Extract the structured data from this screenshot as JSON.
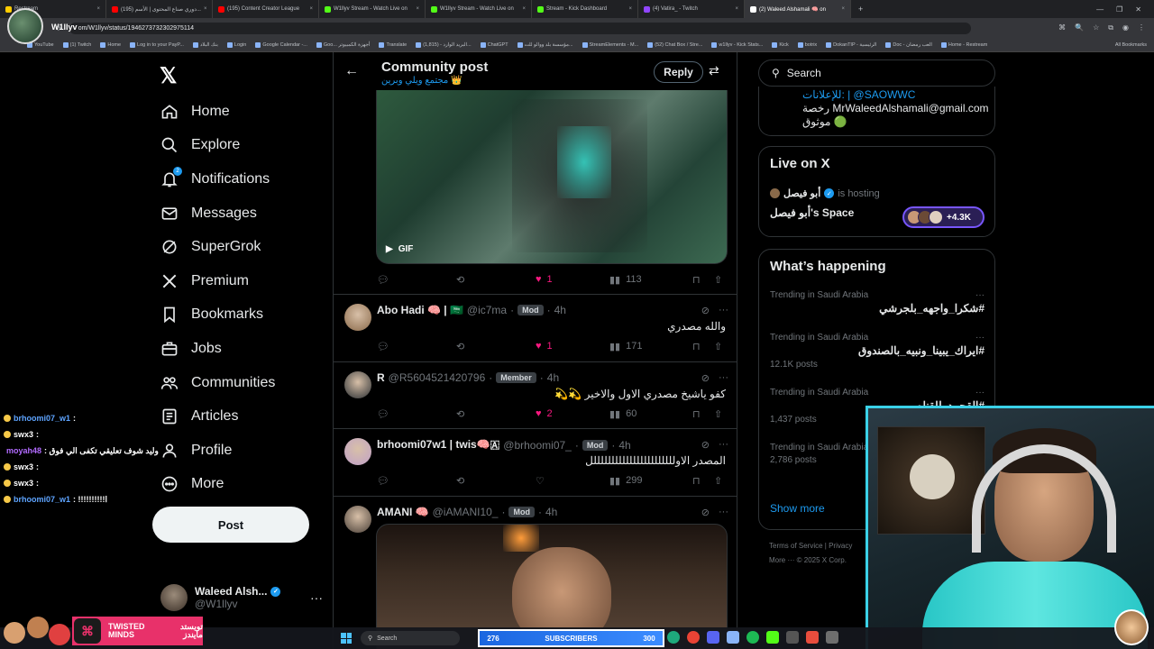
{
  "browser": {
    "tabs": [
      {
        "title": "Restream",
        "color": "#ffcc00",
        "active": false
      },
      {
        "title": "(195) دوري صناع المحتوى | الأسم...",
        "color": "#ff0000",
        "active": false
      },
      {
        "title": "(195) Content Creator League",
        "color": "#ff0000",
        "active": false
      },
      {
        "title": "W1llyv Stream - Watch Live on",
        "color": "#53fc18",
        "active": false
      },
      {
        "title": "W1llyv Stream - Watch Live on",
        "color": "#53fc18",
        "active": false
      },
      {
        "title": "Stream - Kick Dashboard",
        "color": "#53fc18",
        "active": false
      },
      {
        "title": "(4) Vatira_ - Twitch",
        "color": "#9146ff",
        "active": false
      },
      {
        "title": "(2) Waleed Alshamali 🧠 on",
        "color": "#ffffff",
        "active": true
      }
    ],
    "url": "om/W1llyv/status/1946273732302975114",
    "bookmarks": [
      "YouTube",
      "(1) Twitch",
      "Home",
      "Log in to your PayP...",
      "بنك البلاد",
      "Login",
      "Google Calendar -...",
      "Goo... أجهزة الكمبيوتر",
      "Translate",
      "البريد الوارد - (1,815)...",
      "ChatGPT",
      "مؤسسة بلد ووالو للت...",
      "StreamElements - M...",
      "(52) Chat Box / Stre...",
      "w1llyv - Kick Stats...",
      "Kick",
      "botrix",
      "DokanTIP - الرئيسية",
      "Doc - العب رمضان",
      "Home - Restream"
    ],
    "all_bookmarks": "All Bookmarks"
  },
  "streamer": {
    "name": "W1llyv"
  },
  "nav": {
    "items": [
      {
        "label": "Home",
        "icon": "home-icon"
      },
      {
        "label": "Explore",
        "icon": "search-icon"
      },
      {
        "label": "Notifications",
        "icon": "bell-icon",
        "badge": "2"
      },
      {
        "label": "Messages",
        "icon": "envelope-icon"
      },
      {
        "label": "SuperGrok",
        "icon": "grok-icon"
      },
      {
        "label": "Premium",
        "icon": "x-logo-icon"
      },
      {
        "label": "Bookmarks",
        "icon": "bookmark-icon"
      },
      {
        "label": "Jobs",
        "icon": "briefcase-icon"
      },
      {
        "label": "Communities",
        "icon": "people-icon"
      },
      {
        "label": "Articles",
        "icon": "article-icon"
      },
      {
        "label": "Profile",
        "icon": "person-icon"
      },
      {
        "label": "More",
        "icon": "more-circle-icon"
      }
    ],
    "post_label": "Post"
  },
  "account": {
    "name": "Waleed Alsh...",
    "handle": "@W1llyv"
  },
  "chat": [
    {
      "user": "brhoomi07_w1",
      "text": ":",
      "color": "#5ea4ff"
    },
    {
      "user": "swx3",
      "text": ":",
      "color": "#ffffff"
    },
    {
      "user": "moyah48",
      "text": ": وليد شوف تعليقي تكفى الي فوق",
      "color": "#b26bff"
    },
    {
      "user": "swx3",
      "text": ":",
      "color": "#ffffff"
    },
    {
      "user": "swx3",
      "text": ":",
      "color": "#ffffff"
    },
    {
      "user": "brhoomi07_w1",
      "text": ": !!!!!!!!!!ا",
      "color": "#5ea4ff"
    }
  ],
  "header": {
    "title": "Community post",
    "subtitle": "مجتمع ويلي وبرين 👑",
    "reply_label": "Reply"
  },
  "gif_post": {
    "gif_label": "GIF",
    "likes": "1",
    "views": "113"
  },
  "tweets": [
    {
      "name": "Abo Hadi 🧠 | 🇸🇦",
      "handle": "@ic7ma",
      "role": "Mod",
      "time": "4h",
      "text": "والله مصدري",
      "likes": "1",
      "views": "171",
      "liked": true,
      "avatar": "#8a6a4a"
    },
    {
      "name": "R",
      "handle": "@R5604521420796",
      "role": "Member",
      "time": "4h",
      "text": "كفو ياشيخ مصدري الاول والاخير 💫💫",
      "likes": "2",
      "views": "60",
      "liked": true,
      "avatar": "#2a2f33"
    },
    {
      "name": "brhoomi07w1 | twis🧠🇦",
      "handle": "@brhoomi07_",
      "role": "Mod",
      "time": "4h",
      "text": "المصدر الاولللللللللللللللللللللللل",
      "likes": "",
      "views": "299",
      "liked": false,
      "avatar": "#c0a0c8"
    },
    {
      "name": "AMANI 🧠",
      "handle": "@iAMANI10_",
      "role": "Mod",
      "time": "4h",
      "text": "",
      "likes": "",
      "views": "",
      "liked": false,
      "avatar": "#4a4038"
    }
  ],
  "right": {
    "search_placeholder": "Search",
    "bio_lines": [
      "للإعلانات: | @SAOWWC",
      "رخصة MrWaleedAlshamali@gmail.com",
      "موثوق 🟢"
    ],
    "live": {
      "title": "Live on X",
      "host": "أبو فيصل",
      "host_status": "is hosting",
      "space": "أبو فيصل's Space",
      "count": "+4.3K"
    },
    "happening": {
      "title": "What’s happening",
      "trends": [
        {
          "context": "Trending in Saudi Arabia",
          "name": "#شكرا_واجهه_بلجرشي",
          "count": ""
        },
        {
          "context": "Trending in Saudi Arabia",
          "name": "#ايراك_يبينا_ونبيه_بالصندوق",
          "count": "12.1K posts"
        },
        {
          "context": "Trending in Saudi Arabia",
          "name": "#القحمد_للقناه",
          "count": "1,437 posts"
        },
        {
          "context": "Trending in Saudi Arabia",
          "name": "",
          "count": "2,786 posts"
        }
      ],
      "show_more": "Show more"
    },
    "footer": [
      "Terms of Service | Privacy",
      "More ··· © 2025 X Corp."
    ]
  },
  "stream": {
    "subs_current": "276",
    "subs_label": "SUBSCRIBERS",
    "subs_goal": "300",
    "sponsor_en": "TWISTED MINDS",
    "sponsor_ar": "تويستد مايندز",
    "taskbar_search": "Search"
  },
  "colors": {
    "accent": "#1d9bf0",
    "like": "#f91880",
    "bg": "#000000",
    "border": "#2f3336",
    "cam_frame": "#3ad1e8"
  }
}
